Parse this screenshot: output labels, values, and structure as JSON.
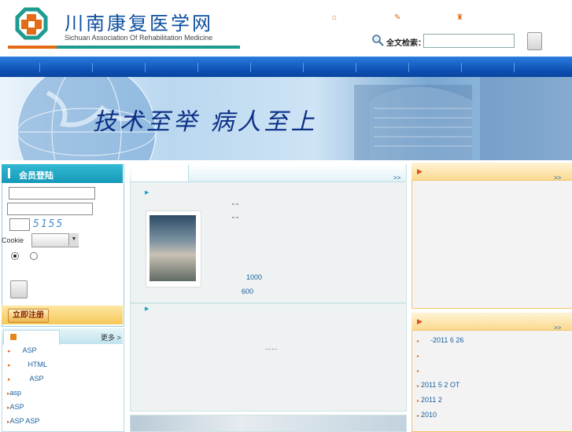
{
  "header": {
    "title": "川南康复医学网",
    "subtitle": "Sichuan Association Of Rehabilitation Medicine",
    "top_icons": [
      "home-icon",
      "bookmark-icon",
      "contact-icon"
    ]
  },
  "search": {
    "label": "全文检索：",
    "value": "",
    "placeholder": ""
  },
  "banner": {
    "slogan": "技术至举  病人至上"
  },
  "login": {
    "title": "会员登陆",
    "username_value": "",
    "password_value": "",
    "code_value": "",
    "captcha_text": "5155",
    "cookie_label": "Cookie",
    "cookie_value": "",
    "register_label": "立即注册"
  },
  "left_news": {
    "more_label": "更多 >",
    "items": [
      {
        "text": "ASP"
      },
      {
        "text": "HTML"
      },
      {
        "text": "ASP"
      },
      {
        "text": "asp"
      },
      {
        "text": "ASP"
      },
      {
        "text": "ASP   ASP"
      }
    ]
  },
  "middle": {
    "more_label": ">>",
    "quote1": "\"   \"",
    "quote2": "\"   \"",
    "number1": "1000",
    "number2": "600",
    "ellipsis": "……"
  },
  "right": {
    "box1_more": ">>",
    "box2_more": ">>",
    "items": [
      {
        "text": "-2011 6 26"
      },
      {
        "text": ""
      },
      {
        "text": ""
      },
      {
        "text": "2011 5      2 OT"
      },
      {
        "text": "2011 2"
      },
      {
        "text": "2010"
      }
    ]
  },
  "colors": {
    "brand_blue": "#0b4e9e",
    "accent_orange": "#e36b16",
    "accent_teal": "#1f9b8f",
    "nav_blue": "#0c4fb2"
  }
}
